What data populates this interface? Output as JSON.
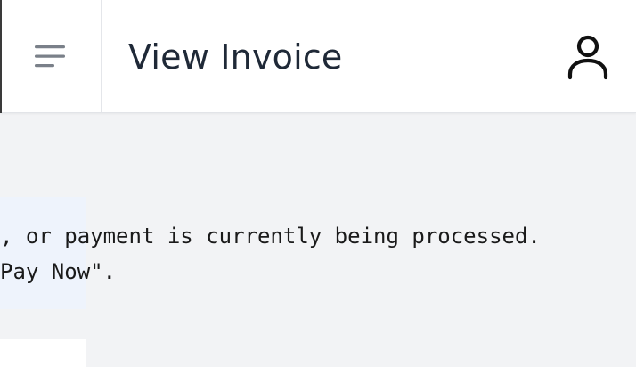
{
  "header": {
    "title": "View Invoice",
    "menu_icon": "hamburger-menu-icon",
    "user_icon": "user-account-icon"
  },
  "notice": {
    "line1": ", or payment is currently being processed.",
    "line2": "Pay Now\"."
  },
  "colors": {
    "background": "#f2f3f5",
    "header_bg": "#ffffff",
    "title_text": "#1f2937",
    "notice_bg": "#eef3fc",
    "icon_menu": "#7a8089",
    "icon_user": "#111111"
  }
}
